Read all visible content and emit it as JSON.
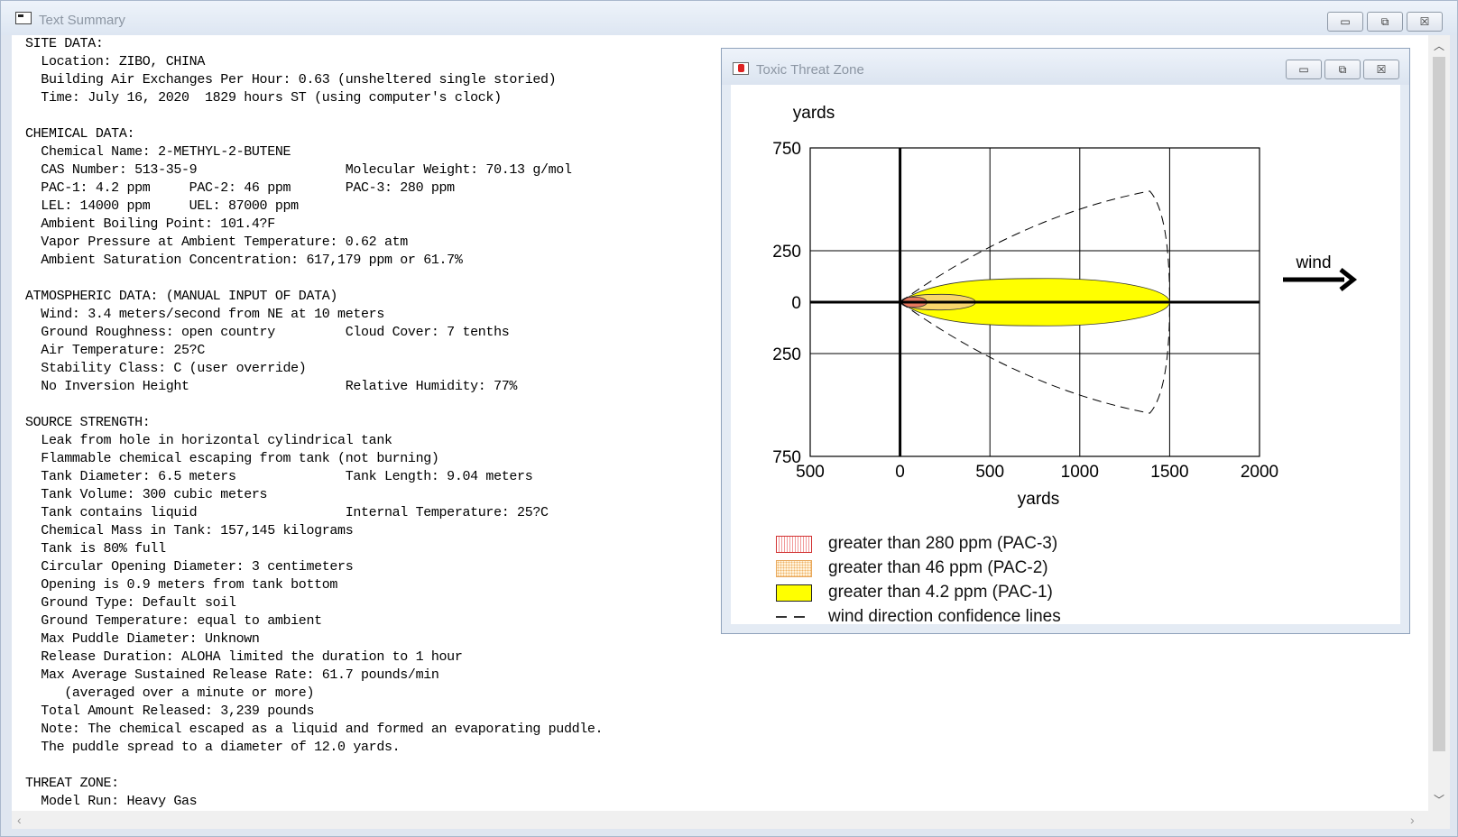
{
  "outer_window": {
    "title": "Text Summary",
    "buttons": {
      "minimize": "▭",
      "maximize": "⧉",
      "close": "☒"
    }
  },
  "summary": {
    "lines": [
      "SITE DATA:",
      "  Location: ZIBO, CHINA",
      "  Building Air Exchanges Per Hour: 0.63 (unsheltered single storied)",
      "  Time: July 16, 2020  1829 hours ST (using computer's clock)",
      "",
      "CHEMICAL DATA:",
      "  Chemical Name: 2-METHYL-2-BUTENE",
      "  CAS Number: 513-35-9                   Molecular Weight: 70.13 g/mol",
      "  PAC-1: 4.2 ppm     PAC-2: 46 ppm       PAC-3: 280 ppm",
      "  LEL: 14000 ppm     UEL: 87000 ppm",
      "  Ambient Boiling Point: 101.4?F",
      "  Vapor Pressure at Ambient Temperature: 0.62 atm",
      "  Ambient Saturation Concentration: 617,179 ppm or 61.7%",
      "",
      "ATMOSPHERIC DATA: (MANUAL INPUT OF DATA)",
      "  Wind: 3.4 meters/second from NE at 10 meters",
      "  Ground Roughness: open country         Cloud Cover: 7 tenths",
      "  Air Temperature: 25?C",
      "  Stability Class: C (user override)",
      "  No Inversion Height                    Relative Humidity: 77%",
      "",
      "SOURCE STRENGTH:",
      "  Leak from hole in horizontal cylindrical tank",
      "  Flammable chemical escaping from tank (not burning)",
      "  Tank Diameter: 6.5 meters              Tank Length: 9.04 meters",
      "  Tank Volume: 300 cubic meters",
      "  Tank contains liquid                   Internal Temperature: 25?C",
      "  Chemical Mass in Tank: 157,145 kilograms",
      "  Tank is 80% full",
      "  Circular Opening Diameter: 3 centimeters",
      "  Opening is 0.9 meters from tank bottom",
      "  Ground Type: Default soil",
      "  Ground Temperature: equal to ambient",
      "  Max Puddle Diameter: Unknown",
      "  Release Duration: ALOHA limited the duration to 1 hour",
      "  Max Average Sustained Release Rate: 61.7 pounds/min",
      "     (averaged over a minute or more)",
      "  Total Amount Released: 3,239 pounds",
      "  Note: The chemical escaped as a liquid and formed an evaporating puddle.",
      "  The puddle spread to a diameter of 12.0 yards.",
      "",
      "THREAT ZONE:",
      "  Model Run: Heavy Gas"
    ]
  },
  "inner_window": {
    "title": "Toxic Threat Zone",
    "buttons": {
      "minimize": "▭",
      "maximize": "⧉",
      "close": "☒"
    }
  },
  "chart_data": {
    "type": "area",
    "xlabel": "yards",
    "ylabel": "yards",
    "xlim": [
      -500,
      2000
    ],
    "ylim": [
      -750,
      750
    ],
    "x_ticks": [
      -500,
      0,
      500,
      1000,
      1500,
      2000
    ],
    "x_tick_labels": [
      "500",
      "0",
      "500",
      "1000",
      "1500",
      "2000"
    ],
    "y_ticks": [
      750,
      250,
      0,
      -250,
      -750
    ],
    "y_tick_labels": [
      "750",
      "250",
      "0",
      "250",
      "750"
    ],
    "grid": true,
    "wind_label": "wind",
    "zones": [
      {
        "name": "PAC-1",
        "x_start": 0,
        "x_end": 1500,
        "half_width": 115,
        "color": "#ffff00"
      },
      {
        "name": "PAC-2",
        "x_start": 0,
        "x_end": 420,
        "half_width": 38,
        "color": "#f6c890"
      },
      {
        "name": "PAC-3",
        "x_start": 0,
        "x_end": 150,
        "half_width": 25,
        "color": "#e25a5a"
      }
    ],
    "confidence_lines": {
      "x_max": 1500,
      "half_width": 540
    },
    "legend": [
      {
        "key": "pac3",
        "label": "greater than 280 ppm (PAC-3)"
      },
      {
        "key": "pac2",
        "label": "greater than 46 ppm (PAC-2)"
      },
      {
        "key": "pac1",
        "label": "greater than 4.2 ppm (PAC-1)"
      },
      {
        "key": "wind",
        "label": "wind direction confidence lines"
      }
    ],
    "legend_placement": "bottom-left"
  }
}
